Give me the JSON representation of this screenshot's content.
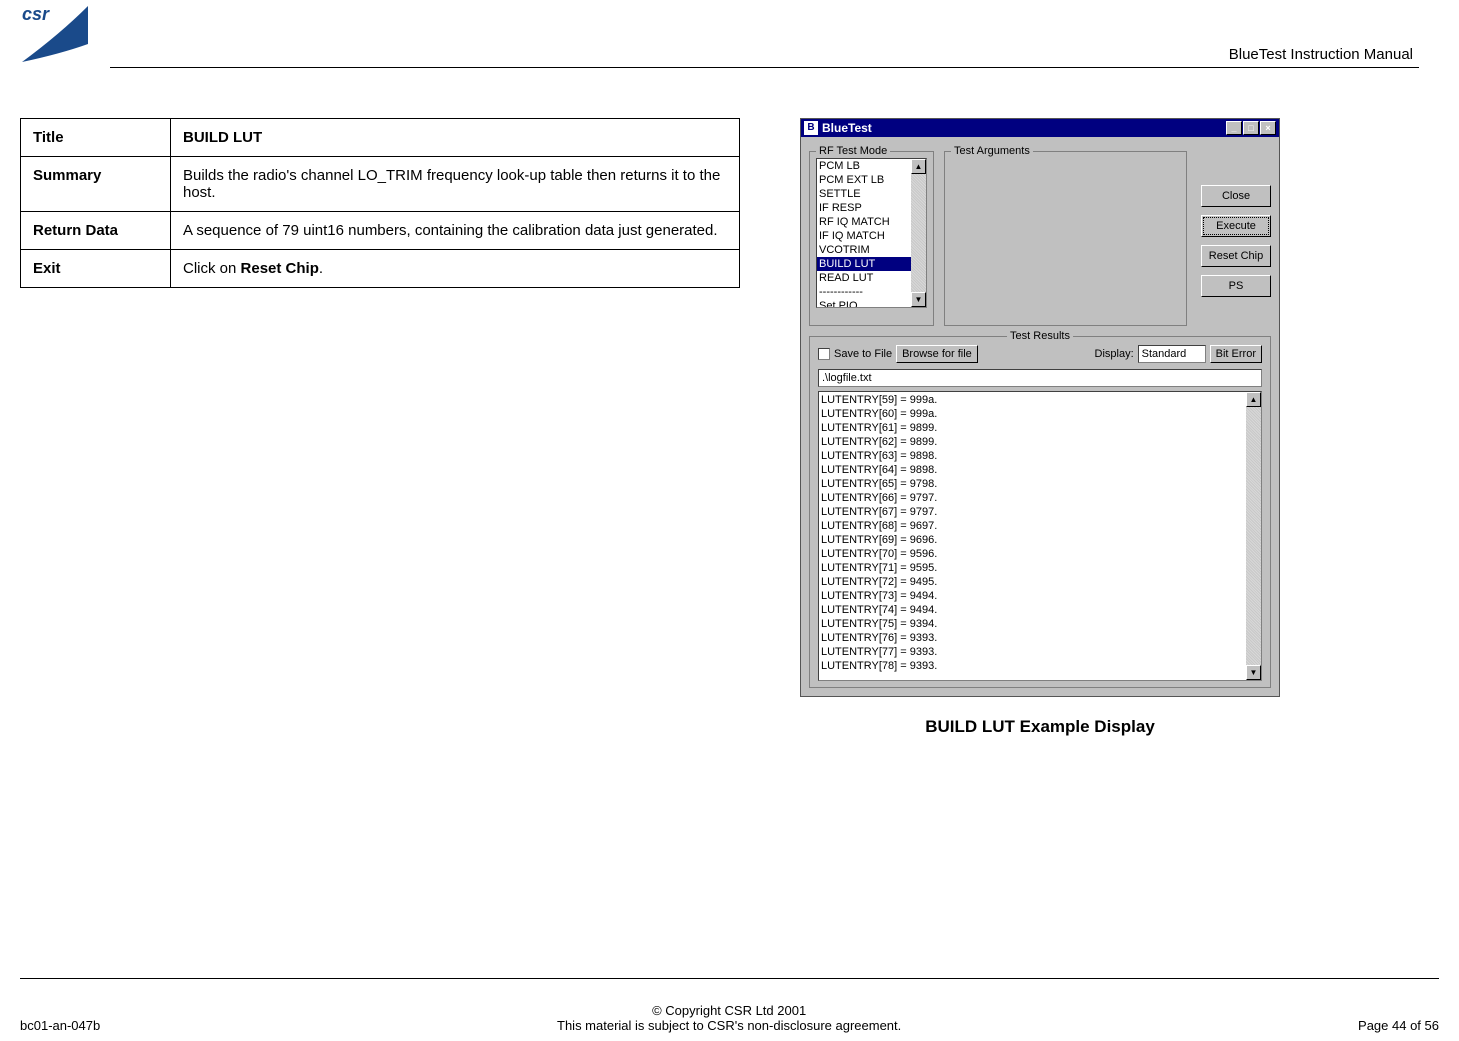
{
  "header": {
    "manual_title": "BlueTest Instruction Manual",
    "logo_text": "csr"
  },
  "table": {
    "rows": [
      {
        "label": "Title",
        "value": "BUILD LUT",
        "value_bold": true
      },
      {
        "label": "Summary",
        "value": "Builds the radio's channel LO_TRIM frequency look-up table then returns it to the host."
      },
      {
        "label": "Return Data",
        "value": "A sequence of 79 uint16 numbers, containing the calibration data just generated."
      },
      {
        "label": "Exit",
        "value_pre": "Click on ",
        "value_bold_part": "Reset Chip",
        "value_post": "."
      }
    ]
  },
  "app": {
    "title": "BlueTest",
    "fieldset_rf": "RF Test Mode",
    "fieldset_args": "Test Arguments",
    "fieldset_results": "Test Results",
    "rf_items": [
      "PCM LB",
      "PCM EXT LB",
      "SETTLE",
      "IF RESP",
      "RF IQ MATCH",
      "IF IQ MATCH",
      "VCOTRIM",
      "BUILD LUT",
      "READ LUT",
      "------------",
      "Set PIO"
    ],
    "rf_selected_index": 7,
    "buttons": {
      "close": "Close",
      "execute": "Execute",
      "reset": "Reset Chip",
      "ps": "PS",
      "browse": "Browse for file",
      "biterror": "Bit Error"
    },
    "save_to_file": "Save to File",
    "display_label": "Display:",
    "display_value": "Standard",
    "logfile": ".\\logfile.txt",
    "results": [
      "LUTENTRY[59] = 999a.",
      "LUTENTRY[60] = 999a.",
      "LUTENTRY[61] = 9899.",
      "LUTENTRY[62] = 9899.",
      "LUTENTRY[63] = 9898.",
      "LUTENTRY[64] = 9898.",
      "LUTENTRY[65] = 9798.",
      "LUTENTRY[66] = 9797.",
      "LUTENTRY[67] = 9797.",
      "LUTENTRY[68] = 9697.",
      "LUTENTRY[69] = 9696.",
      "LUTENTRY[70] = 9596.",
      "LUTENTRY[71] = 9595.",
      "LUTENTRY[72] = 9495.",
      "LUTENTRY[73] = 9494.",
      "LUTENTRY[74] = 9494.",
      "LUTENTRY[75] = 9394.",
      "LUTENTRY[76] = 9393.",
      "LUTENTRY[77] = 9393.",
      "LUTENTRY[78] = 9393."
    ]
  },
  "caption": "BUILD LUT Example Display",
  "footer": {
    "left": "bc01-an-047b",
    "copyright": "© Copyright CSR Ltd 2001",
    "agreement": "This material is subject to CSR's non-disclosure agreement.",
    "page": "Page 44 of 56"
  }
}
